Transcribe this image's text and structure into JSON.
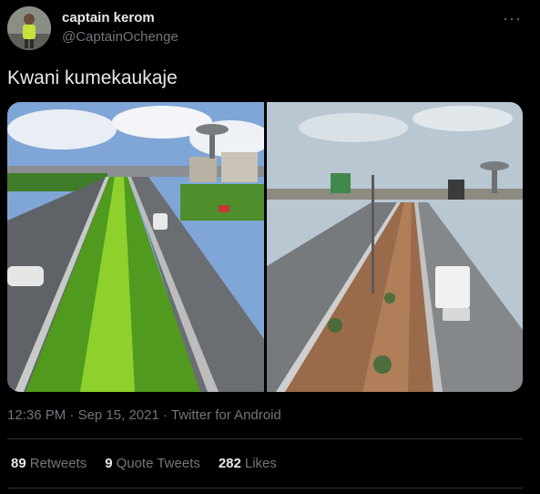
{
  "user": {
    "display_name": "captain kerom",
    "handle": "@CaptainOchenge"
  },
  "menu_glyph": "···",
  "tweet_text": "Kwani kumekaukaje",
  "meta": {
    "time": "12:36 PM",
    "sep1": " · ",
    "date": "Sep 15, 2021",
    "sep2": " · ",
    "source": "Twitter for Android"
  },
  "stats": {
    "retweets_count": "89",
    "retweets_label": "Retweets",
    "quotes_count": "9",
    "quotes_label": "Quote Tweets",
    "likes_count": "282",
    "likes_label": "Likes"
  },
  "colors": {
    "background": "#000000",
    "primary_text": "#e7e9ea",
    "secondary_text": "#71767b",
    "divider": "#2f3336"
  }
}
